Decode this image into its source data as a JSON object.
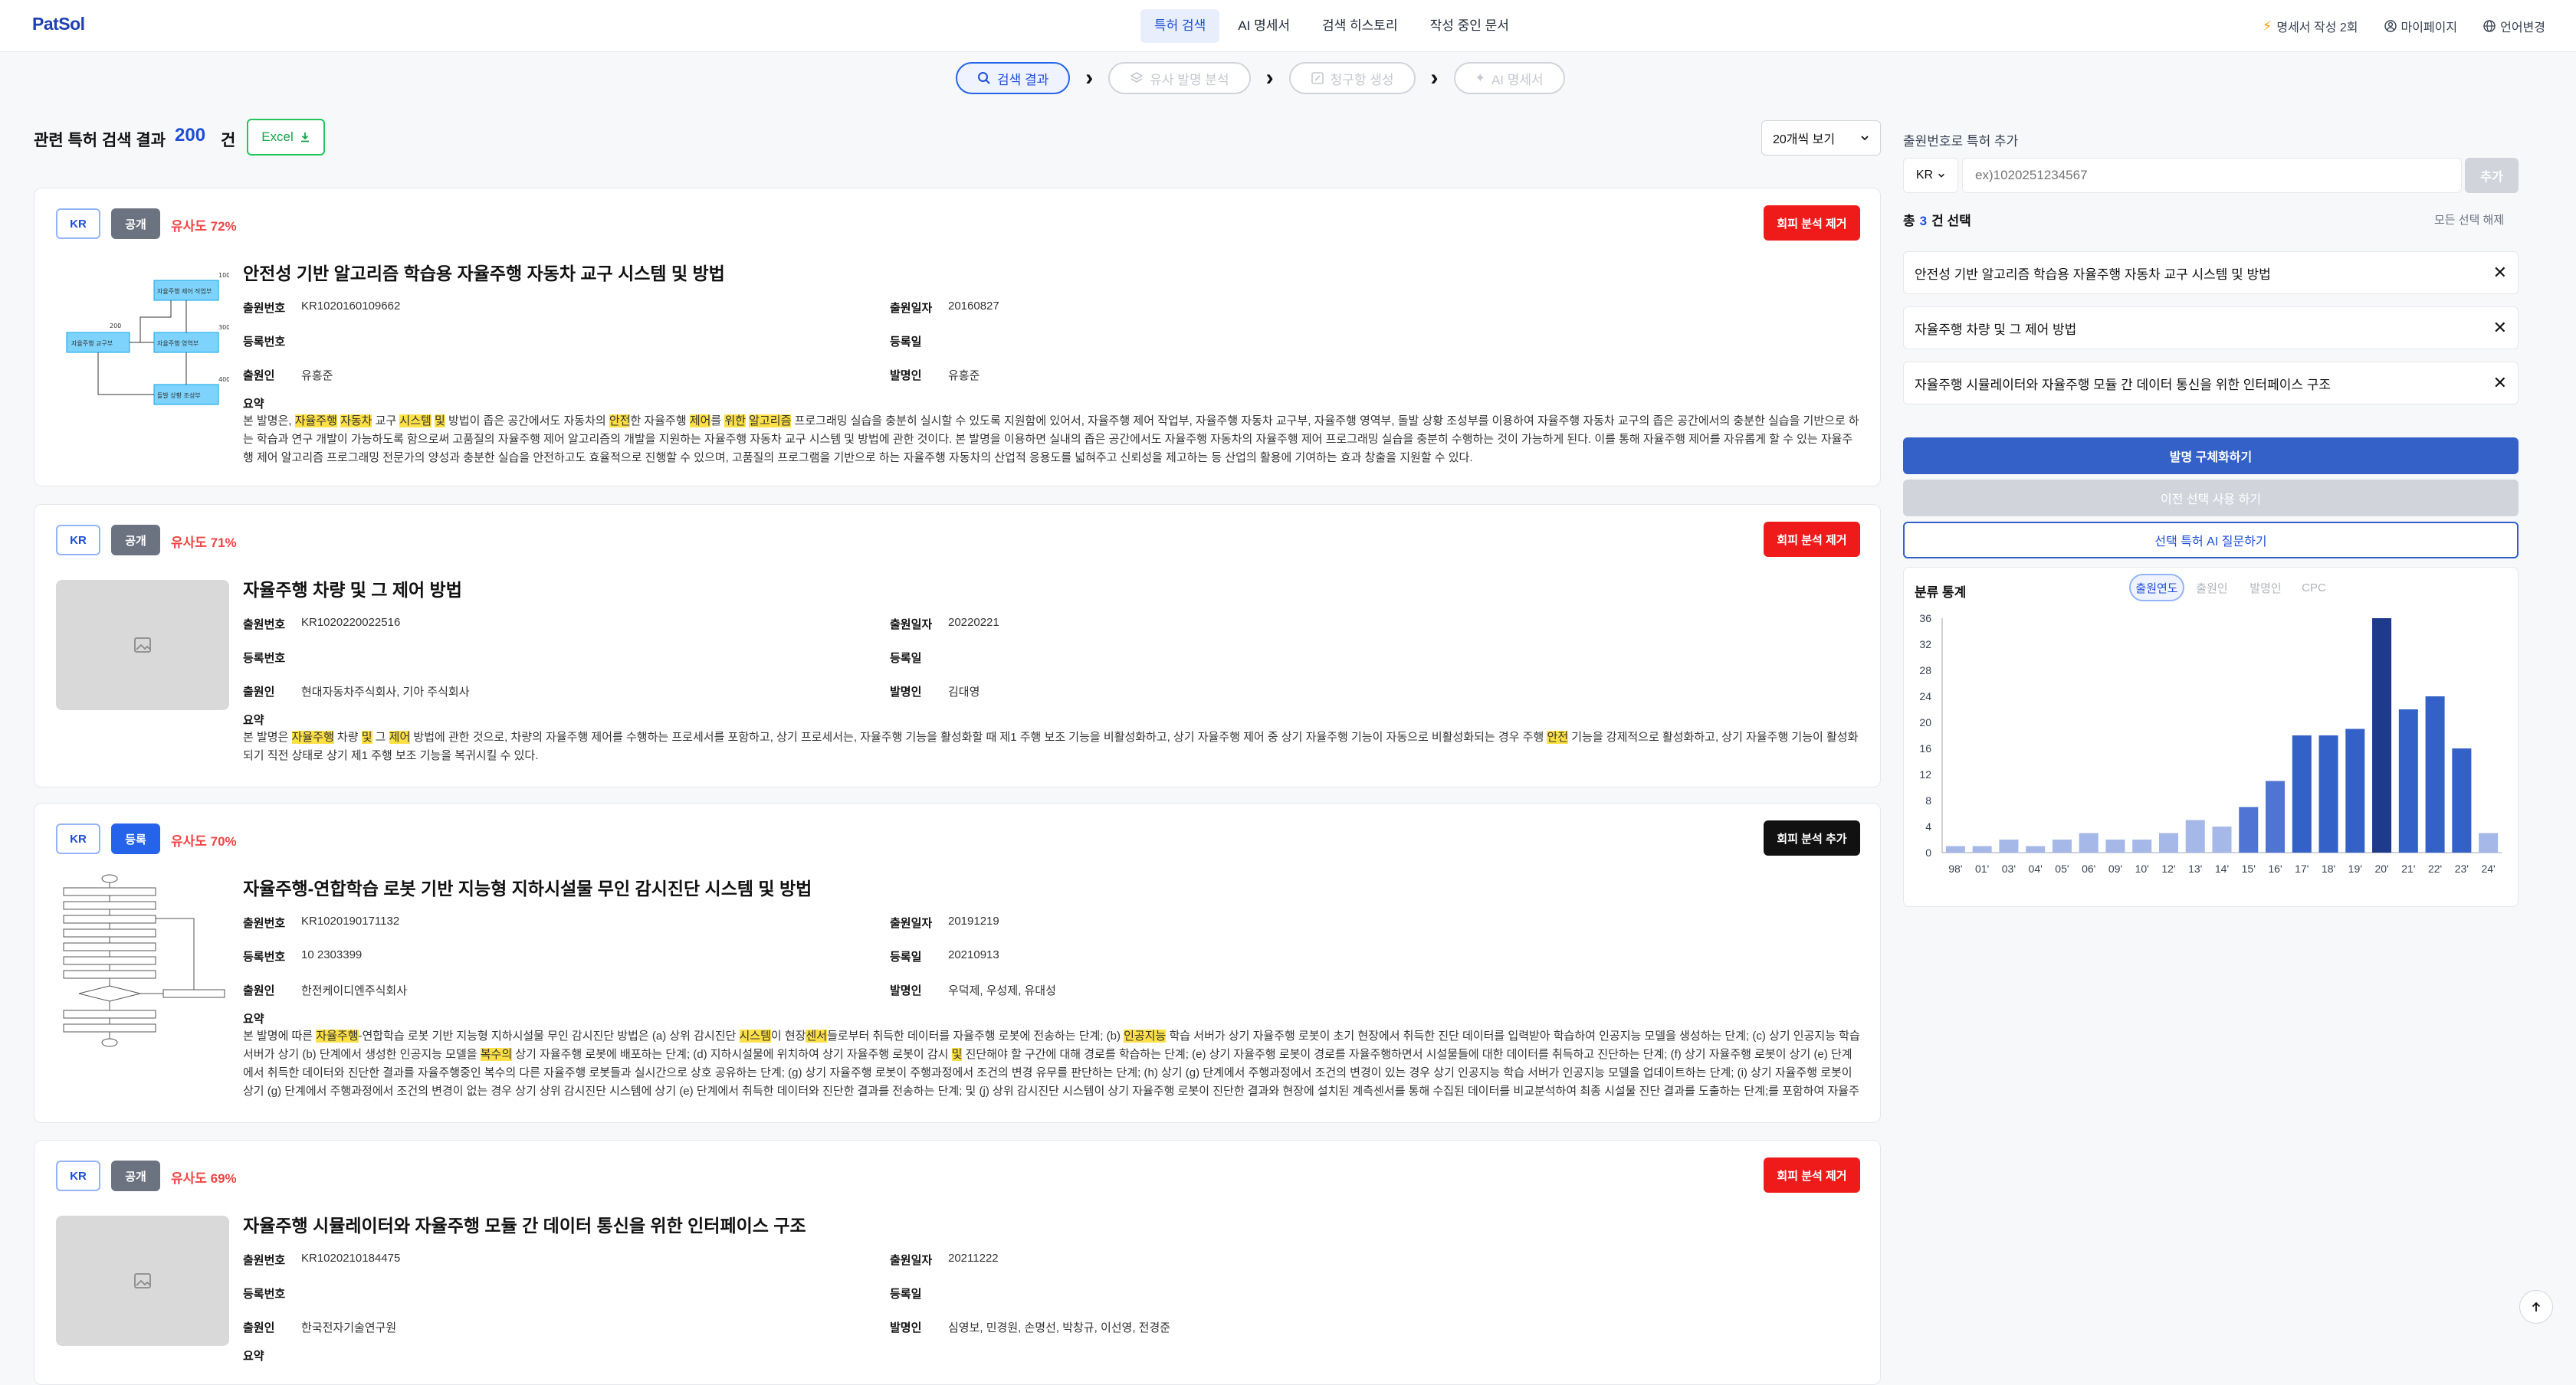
{
  "nav": {
    "logo": "PatSol",
    "menu": [
      "특허 검색",
      "AI 명세서",
      "검색 히스토리",
      "작성 중인 문서"
    ],
    "credits": "명세서 작성 2회",
    "mypage": "마이페이지",
    "language": "언어변경"
  },
  "steps": [
    "검색 결과",
    "유사 발명 분석",
    "청구항 생성",
    "AI 명세서"
  ],
  "results": {
    "title": "관련 특허 검색 결과",
    "count": "200",
    "unit": "건",
    "excel_label": "Excel",
    "per_page": "20개씩 보기"
  },
  "labels": {
    "app_no": "출원번호",
    "app_date": "출원일자",
    "reg_no": "등록번호",
    "reg_date": "등록일",
    "applicant": "출원인",
    "inventor": "발명인",
    "abstract": "요약"
  },
  "patents": [
    {
      "country": "KR",
      "status": "공개",
      "similarity": "유사도 72%",
      "action": "회피 분석 제거",
      "title": "안전성 기반 알고리즘 학습용 자율주행 자동차 교구 시스템 및 방법",
      "app_no": "KR1020160109662",
      "app_date": "20160827",
      "reg_no": "",
      "reg_date": "",
      "applicant": "유홍준",
      "inventor": "유홍준",
      "abstract_html": "본 발명은, <span class=\"hl\">자율주행</span> <span class=\"hl\">자동차</span> 교구 <span class=\"hl\">시스템</span> <span class=\"hl\">및</span> 방법이 좁은 공간에서도 자동차의 <span class=\"hl\">안전</span>한 자율주행 <span class=\"hl\">제어</span>를 <span class=\"hl\">위한</span> <span class=\"hl\">알고리즘</span> 프로그래밍 실습을 충분히 실시할 수 있도록 지원함에 있어서, 자율주행 제어 작업부, 자율주행 자동차 교구부, 자율주행 영역부, 돌발 상황 조성부를 이용하여 자율주행 자동차 교구의 좁은 공간에서의 충분한 실습을 기반으로 하는 학습과 연구 개발이 가능하도록 함으로써 고품질의 자율주행 제어 알고리즘의 개발을 지원하는 자율주행 자동차 교구 시스템 및 방법에 관한 것이다. 본 발명을 이용하면 실내의 좁은 공간에서도 자율주행 자동차의 자율주행 제어 프로그래밍 실습을 충분히 수행하는 것이 가능하게 된다. 이를 통해 자율주행 제어를 자유롭게 할 수 있는 자율주행 제어 알고리즘 프로그래밍 전문가의 양성과 충분한 실습을 안전하고도 효율적으로 진행할 수 있으며, 고품질의 프로그램을 기반으로 하는 자율주행 자동차의 산업적 응용도를 넓혀주고 신뢰성을 제고하는 등 산업의 활용에 기여하는 효과 창출을 지원할 수 있다."
    },
    {
      "country": "KR",
      "status": "공개",
      "similarity": "유사도 71%",
      "action": "회피 분석 제거",
      "title": "자율주행 차량 및 그 제어 방법",
      "app_no": "KR1020220022516",
      "app_date": "20220221",
      "reg_no": "",
      "reg_date": "",
      "applicant": "현대자동차주식회사, 기아 주식회사",
      "inventor": "김대영",
      "abstract_html": "본 발명은 <span class=\"hl\">자율주행</span> 차량 <span class=\"hl\">및</span> 그 <span class=\"hl\">제어</span> 방법에 관한 것으로, 차량의 자율주행 제어를 수행하는 프로세서를 포함하고, 상기 프로세서는, 자율주행 기능을 활성화할 때 제1 주행 보조 기능을 비활성화하고, 상기 자율주행 제어 중 상기 자율주행 기능이 자동으로 비활성화되는 경우 주행 <span class=\"hl\">안전</span> 기능을 강제적으로 활성화하고, 상기 자율주행 기능이 활성화되기 직전 상태로 상기 제1 주행 보조 기능을 복귀시킬 수 있다."
    },
    {
      "country": "KR",
      "status": "등록",
      "similarity": "유사도 70%",
      "action": "회피 분석 추가",
      "title": "자율주행-연합학습 로봇 기반 지능형 지하시설물 무인 감시진단 시스템 및 방법",
      "app_no": "KR1020190171132",
      "app_date": "20191219",
      "reg_no": "10 2303399",
      "reg_date": "20210913",
      "applicant": "한전케이디엔주식회사",
      "inventor": "우덕제, 우성제, 유대성",
      "abstract_html": "본 발명에 따른 <span class=\"hl\">자율주행</span>-연합학습 로봇 기반 지능형 지하시설물 무인 감시진단 방법은 (a) 상위 감시진단 <span class=\"hl\">시스템</span>이 현장<span class=\"hl\">센서</span>들로부터 취득한 데이터를 자율주행 로봇에 전송하는 단계; (b) <span class=\"hl\">인공지능</span> 학습 서버가 상기 자율주행 로봇이 초기 현장에서 취득한 진단 데이터를 입력받아 학습하여 인공지능 모델을 생성하는 단계; (c) 상기 인공지능 학습 서버가 상기 (b) 단계에서 생성한 인공지능 모델을 <span class=\"hl\">복수의</span> 상기 자율주행 로봇에 배포하는 단계; (d) 지하시설물에 위치하여 상기 자율주행 로봇이 감시 <span class=\"hl\">및</span> 진단해야 할 구간에 대해 경로를 학습하는 단계; (e) 상기 자율주행 로봇이 경로를 자율주행하면서 시설물들에 대한 데이터를 취득하고 진단하는 단계; (f) 상기 자율주행 로봇이 상기 (e) 단계에서 취득한 데이터와 진단한 결과를 자율주행중인 복수의 다른 자율주행 로봇들과 실시간으로 상호 공유하는 단계; (g) 상기 자율주행 로봇이 주행과정에서 조건의 변경 유무를 판단하는 단계; (h) 상기 (g) 단계에서 주행과정에서 조건의 변경이 있는 경우 상기 인공지능 학습 서버가 인공지능 모델을 업데이트하는 단계; (i) 상기 자율주행 로봇이 상기 (g) 단계에서 주행과정에서 조건의 변경이 없는 경우 상기 상위 감시진단 시스템에 상기 (e) 단계에서 취득한 데이터와 진단한 결과를 전송하는 단계; 및 (j) 상위 감시진단 시스템이 상기 자율주행 로봇이 진단한 결과와 현장에 설치된 계측센서를 통해 수집된 데이터를 비교분석하여 최종 시설물 진단 결과를 도출하는 단계;를 포함하여 자율주행이 가능한 로봇…"
    },
    {
      "country": "KR",
      "status": "공개",
      "similarity": "유사도 69%",
      "action": "회피 분석 제거",
      "title": "자율주행 시뮬레이터와 자율주행 모듈 간 데이터 통신을 위한 인터페이스 구조",
      "app_no": "KR1020210184475",
      "app_date": "20211222",
      "reg_no": "",
      "reg_date": "",
      "applicant": "한국전자기술연구원",
      "inventor": "심영보, 민경원, 손명선, 박창규, 이선영, 전경준",
      "abstract_html": ""
    }
  ],
  "figure1": {
    "labels": [
      "자율주행 제어 작업부",
      "자율주행 교구부",
      "자율주행 영역부",
      "돌발 상황 조성부"
    ],
    "refs": [
      "100",
      "200",
      "300",
      "400"
    ]
  },
  "panel": {
    "add_label": "출원번호로 특허 추가",
    "country": "KR",
    "input_placeholder": "ex)1020251234567",
    "add_button": "추가",
    "total_prefix": "총",
    "total_count": "3",
    "total_suffix": "건 선택",
    "clear_all": "모든 선택 해제",
    "selected": [
      "안전성 기반 알고리즘 학습용 자율주행 자동차 교구 시스템 및 방법",
      "자율주행 차량 및 그 제어 방법",
      "자율주행 시뮬레이터와 자율주행 모듈 간 데이터 통신을 위한 인터페이스 구조"
    ],
    "btn_concretize": "발명 구체화하기",
    "btn_prev": "이전 선택 사용 하기",
    "btn_ai": "선택 특허 AI 질문하기"
  },
  "stats": {
    "title": "분류 통계",
    "tabs": [
      "출원연도",
      "출원인",
      "발명인",
      "CPC"
    ]
  },
  "chart_data": {
    "type": "bar",
    "categories": [
      "98'",
      "01'",
      "03'",
      "04'",
      "05'",
      "06'",
      "09'",
      "10'",
      "12'",
      "13'",
      "14'",
      "15'",
      "16'",
      "17'",
      "18'",
      "19'",
      "20'",
      "21'",
      "22'",
      "23'",
      "24'"
    ],
    "values": [
      1,
      1,
      2,
      1,
      2,
      3,
      2,
      2,
      3,
      5,
      4,
      7,
      11,
      18,
      18,
      19,
      36,
      22,
      24,
      16,
      3
    ],
    "highlight_index": 16,
    "ylim": [
      0,
      36
    ],
    "yticks": [
      0,
      4,
      8,
      12,
      16,
      20,
      24,
      28,
      32,
      36
    ],
    "grid": false,
    "colors": {
      "low": "#a5b8e8",
      "mid": "#4f74d3",
      "high": "#3461c7",
      "max": "#1e3a8a"
    }
  }
}
